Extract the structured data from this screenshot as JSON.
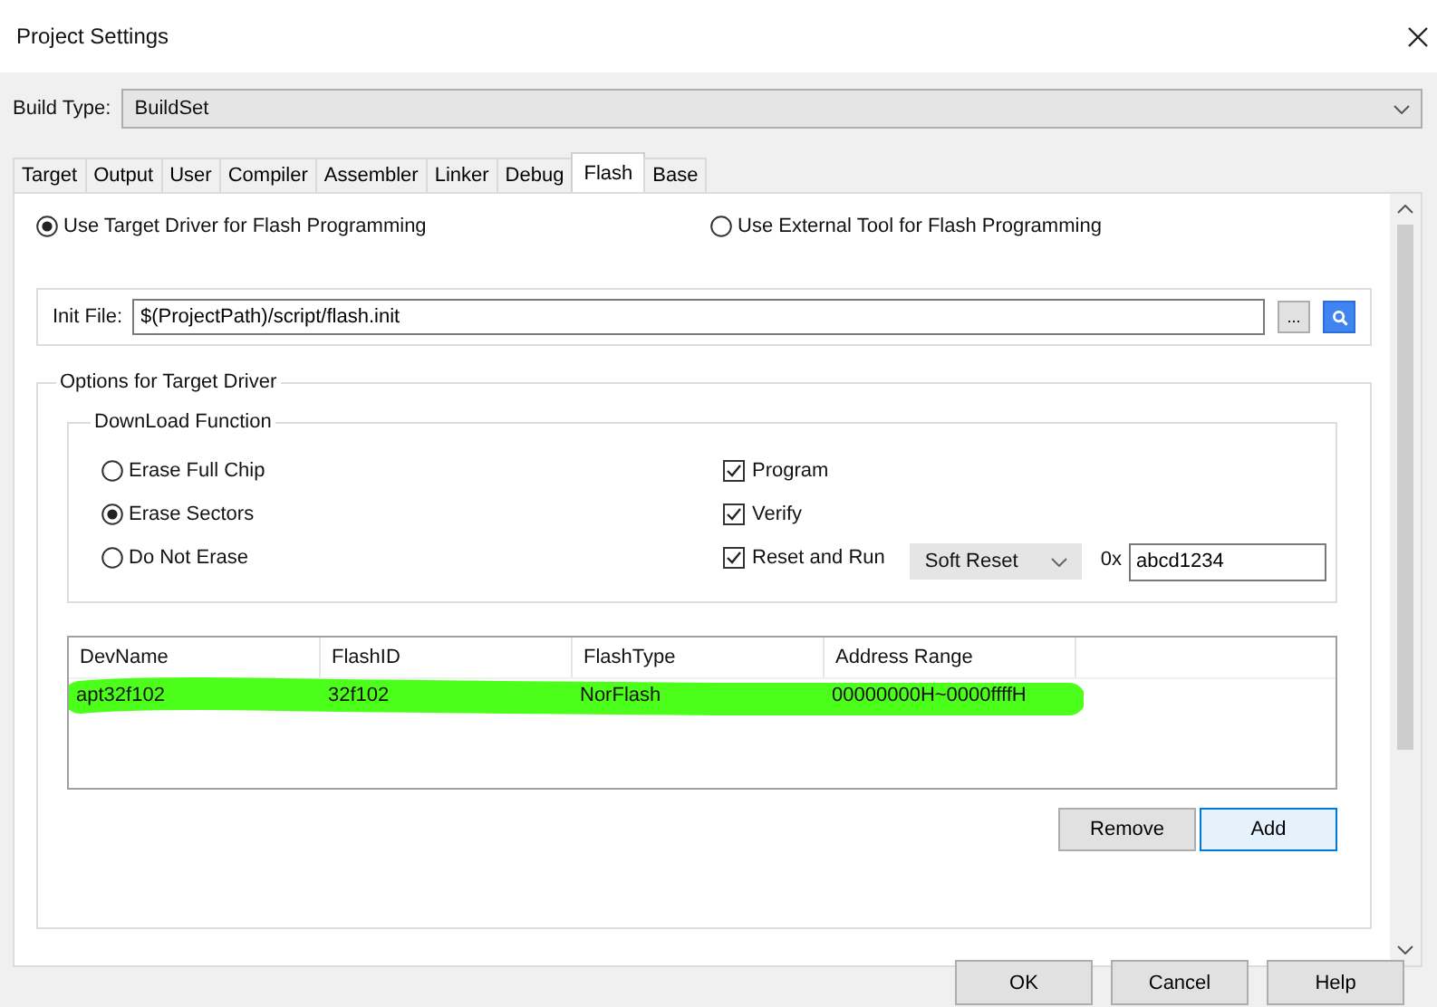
{
  "window": {
    "title": "Project Settings"
  },
  "build_type": {
    "label": "Build Type:",
    "value": "BuildSet"
  },
  "tabs": [
    {
      "label": "Target",
      "selected": false
    },
    {
      "label": "Output",
      "selected": false
    },
    {
      "label": "User",
      "selected": false
    },
    {
      "label": "Compiler",
      "selected": false
    },
    {
      "label": "Assembler",
      "selected": false
    },
    {
      "label": "Linker",
      "selected": false
    },
    {
      "label": "Debug",
      "selected": false
    },
    {
      "label": "Flash",
      "selected": true
    },
    {
      "label": "Base",
      "selected": false
    }
  ],
  "flash_mode": [
    {
      "label": "Use Target Driver for Flash Programming",
      "selected": true
    },
    {
      "label": "Use External Tool for Flash Programming",
      "selected": false
    }
  ],
  "init_file": {
    "label": "Init File:",
    "value": "$(ProjectPath)/script/flash.init",
    "browse": "..."
  },
  "options_group": {
    "title": "Options for Target Driver"
  },
  "download_group": {
    "title": "DownLoad Function"
  },
  "erase": [
    {
      "label": "Erase Full Chip",
      "selected": false
    },
    {
      "label": "Erase Sectors",
      "selected": true
    },
    {
      "label": "Do Not Erase",
      "selected": false
    }
  ],
  "checks": [
    {
      "label": "Program",
      "checked": true
    },
    {
      "label": "Verify",
      "checked": true
    },
    {
      "label": "Reset and Run",
      "checked": true
    }
  ],
  "reset_mode": "Soft Reset",
  "address_prefix": "0x",
  "address": "abcd1234",
  "table": {
    "columns": [
      "DevName",
      "FlashID",
      "FlashType",
      "Address Range"
    ],
    "rows": [
      {
        "cells": [
          "apt32f102",
          "32f102",
          "NorFlash",
          "00000000H~0000ffffH"
        ],
        "marked": true
      }
    ]
  },
  "table_buttons": [
    "Remove",
    "Add"
  ],
  "buttons": [
    "OK",
    "Cancel",
    "Help"
  ]
}
